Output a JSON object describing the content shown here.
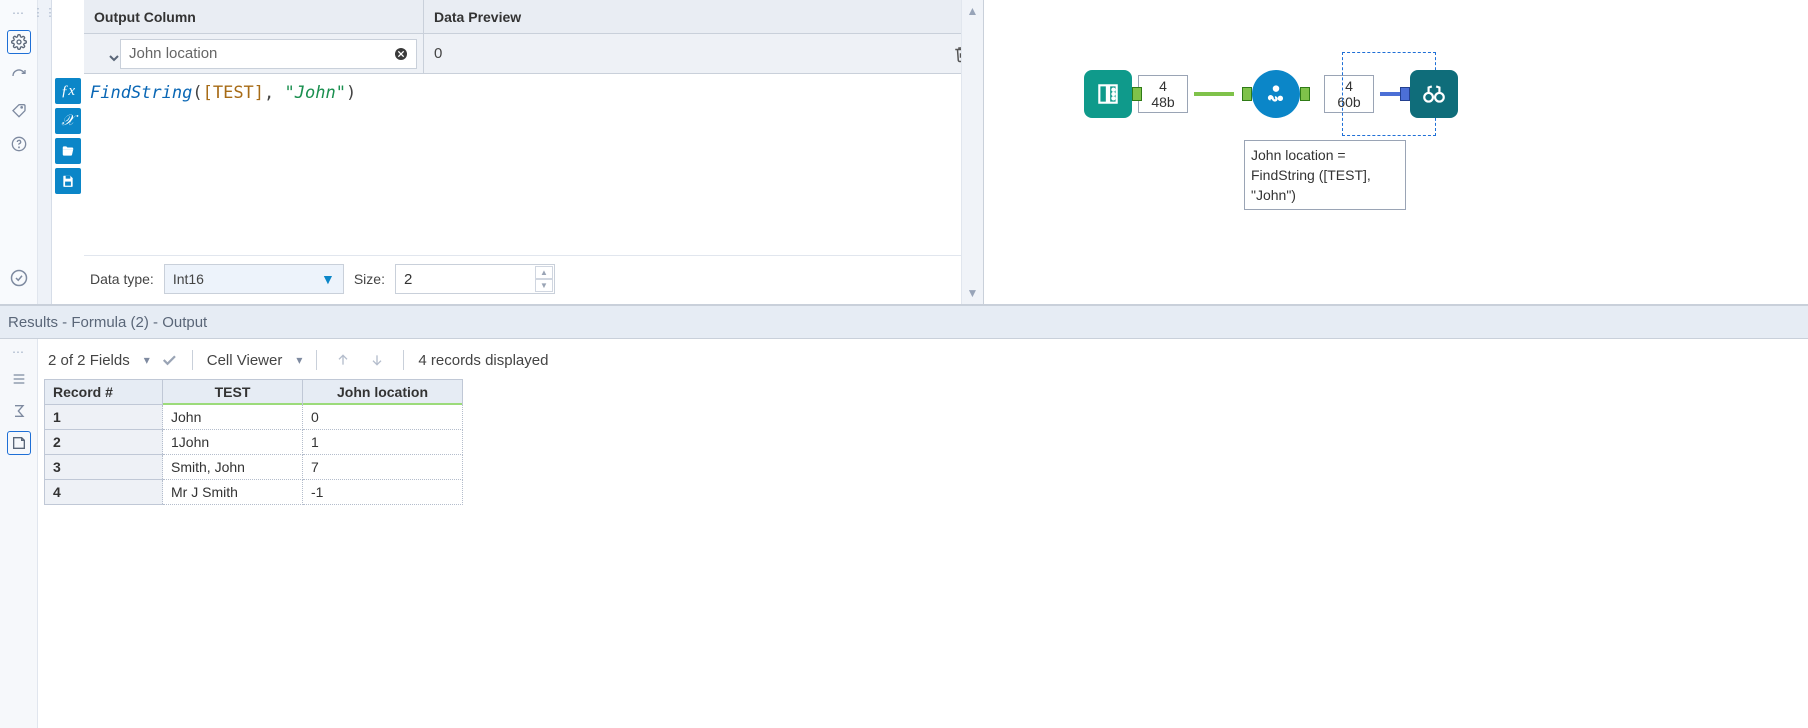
{
  "config": {
    "headers": {
      "output_column": "Output Column",
      "data_preview": "Data Preview"
    },
    "output_column_value": "John location",
    "data_preview_value": "0",
    "formula_tokens": {
      "func": "FindString",
      "open": "(",
      "field": "[TEST]",
      "comma": ", ",
      "str": "\"John\"",
      "close": ")"
    },
    "data_type": {
      "label": "Data type:",
      "value": "Int16"
    },
    "size": {
      "label": "Size:",
      "value": "2"
    }
  },
  "canvas": {
    "conn1": {
      "top": "4",
      "bottom": "48b"
    },
    "conn2": {
      "top": "4",
      "bottom": "60b"
    },
    "formula_caption": "John location = FindString ([TEST], \"John\")"
  },
  "results": {
    "title": "Results - Formula (2) - Output",
    "fields_summary": "2 of 2 Fields",
    "cell_viewer": "Cell Viewer",
    "records_displayed": "4 records displayed",
    "columns": {
      "record": "Record #",
      "test": "TEST",
      "loc": "John location"
    },
    "rows": [
      {
        "n": "1",
        "test": "John",
        "loc": "0"
      },
      {
        "n": "2",
        "test": "1John",
        "loc": "1"
      },
      {
        "n": "3",
        "test": "Smith, John",
        "loc": "7"
      },
      {
        "n": "4",
        "test": "Mr J Smith",
        "loc": "-1"
      }
    ]
  }
}
